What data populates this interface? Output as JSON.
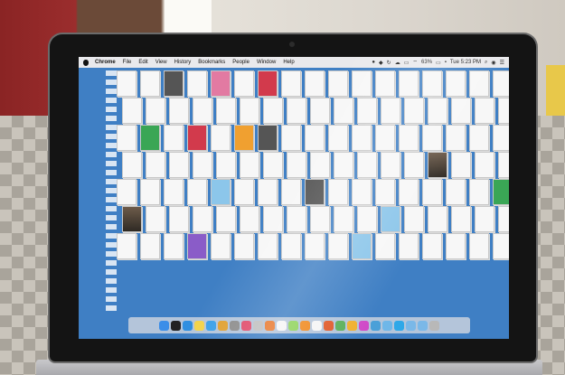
{
  "menubar": {
    "app_name": "Chrome",
    "items": [
      "File",
      "Edit",
      "View",
      "History",
      "Bookmarks",
      "People",
      "Window",
      "Help"
    ],
    "battery": "63%",
    "clock": "Tue 5:23 PM"
  },
  "desktop": {
    "background_color": "#3f7fc4",
    "icon_rows": [
      [
        "file",
        "file",
        "dark",
        "file",
        "pink",
        "file",
        "red",
        "file",
        "file",
        "file",
        "file",
        "file",
        "file",
        "file",
        "file",
        "file",
        "file",
        "file"
      ],
      [
        "file",
        "file",
        "file",
        "file",
        "file",
        "file",
        "file",
        "file",
        "file",
        "file",
        "file",
        "file",
        "file",
        "file",
        "file",
        "file",
        "file",
        "file"
      ],
      [
        "file",
        "green",
        "file",
        "red",
        "file",
        "orange",
        "dark",
        "file",
        "file",
        "file",
        "file",
        "file",
        "file",
        "file",
        "file",
        "file",
        "file",
        "file"
      ],
      [
        "file",
        "file",
        "file",
        "file",
        "file",
        "file",
        "file",
        "file",
        "file",
        "file",
        "file",
        "file",
        "file",
        "photo",
        "file",
        "file",
        "file",
        "file"
      ],
      [
        "file",
        "file",
        "file",
        "file",
        "blue",
        "file",
        "file",
        "file",
        "dark",
        "file",
        "file",
        "file",
        "file",
        "file",
        "file",
        "file",
        "green",
        "file"
      ],
      [
        "photo",
        "file",
        "file",
        "file",
        "file",
        "file",
        "file",
        "file",
        "file",
        "file",
        "file",
        "blue",
        "file",
        "file",
        "file",
        "file",
        "file",
        "file"
      ],
      [
        "file",
        "file",
        "file",
        "purple",
        "file",
        "file",
        "file",
        "file",
        "file",
        "file",
        "blue",
        "file",
        "file",
        "file",
        "file",
        "file",
        "file",
        "file"
      ]
    ]
  },
  "dock": {
    "icons": [
      {
        "name": "finder-icon",
        "color": "#3b8ee8"
      },
      {
        "name": "terminal-icon",
        "color": "#222222"
      },
      {
        "name": "app-store-icon",
        "color": "#2f8fe0"
      },
      {
        "name": "notes-icon",
        "color": "#f3d34a"
      },
      {
        "name": "safari-icon",
        "color": "#3aa0e8"
      },
      {
        "name": "chrome-icon",
        "color": "#e0a030"
      },
      {
        "name": "settings-icon",
        "color": "#8c8c8c"
      },
      {
        "name": "music-icon",
        "color": "#e04a6a"
      },
      {
        "name": "launchpad-icon",
        "color": "#c0c0c0"
      },
      {
        "name": "photos-icon",
        "color": "#e87a30"
      },
      {
        "name": "document-icon",
        "color": "#f5f5f5"
      },
      {
        "name": "messages-icon",
        "color": "#8fd35a"
      },
      {
        "name": "vlc-icon",
        "color": "#f08a20"
      },
      {
        "name": "calendar-icon",
        "color": "#f5f5f5"
      },
      {
        "name": "firefox-icon",
        "color": "#e05a2a"
      },
      {
        "name": "maps-icon",
        "color": "#5ab05a"
      },
      {
        "name": "sketch-icon",
        "color": "#f0b030"
      },
      {
        "name": "itunes-icon",
        "color": "#d04ac8"
      },
      {
        "name": "preview-icon",
        "color": "#4aa0d8"
      },
      {
        "name": "iphoto-icon",
        "color": "#6fb7e8"
      },
      {
        "name": "skype-icon",
        "color": "#2fa8e8"
      },
      {
        "name": "folder-icon",
        "color": "#7ab8e8"
      },
      {
        "name": "downloads-icon",
        "color": "#7ab8e8"
      },
      {
        "name": "trash-icon",
        "color": "#b8b8b8"
      }
    ]
  }
}
